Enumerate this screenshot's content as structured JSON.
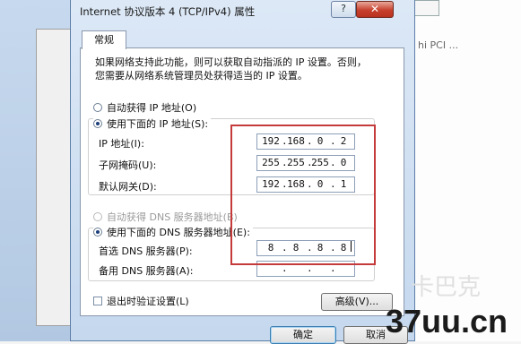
{
  "background": {
    "right_text": "hi PCI ..."
  },
  "dialog": {
    "title": "Internet 协议版本 4 (TCP/IPv4) 属性",
    "help_label": "?",
    "close_label": "✕",
    "tab_label": "常规",
    "description_line1": "如果网络支持此功能，则可以获取自动指派的 IP 设置。否则，",
    "description_line2": "您需要从网络系统管理员处获得适当的 IP 设置。",
    "ip_auto_label": "自动获得 IP 地址(O)",
    "ip_manual_label": "使用下面的 IP 地址(S):",
    "ip_auto_selected": false,
    "ip_manual_selected": true,
    "ip_address_label": "IP 地址(I):",
    "subnet_label": "子网掩码(U):",
    "gateway_label": "默认网关(D):",
    "ip_address": [
      "192",
      "168",
      "0",
      "2"
    ],
    "subnet_mask": [
      "255",
      "255",
      "255",
      "0"
    ],
    "gateway": [
      "192",
      "168",
      "0",
      "1"
    ],
    "dns_auto_label": "自动获得 DNS 服务器地址(B)",
    "dns_manual_label": "使用下面的 DNS 服务器地址(E):",
    "dns_manual_selected": true,
    "preferred_dns_label": "首选 DNS 服务器(P):",
    "alternate_dns_label": "备用 DNS 服务器(A):",
    "preferred_dns": [
      "8",
      "8",
      "8",
      "8"
    ],
    "alternate_dns": [
      "",
      "",
      "",
      ""
    ],
    "validate_label": "退出时验证设置(L)",
    "validate_checked": false,
    "advanced_label": "高级(V)...",
    "ok_label": "确定",
    "cancel_label": "取消",
    "highlight_color": "#c53a3a"
  },
  "watermark": {
    "text": "37uu.cn",
    "ghost_text": "卡巴克"
  }
}
